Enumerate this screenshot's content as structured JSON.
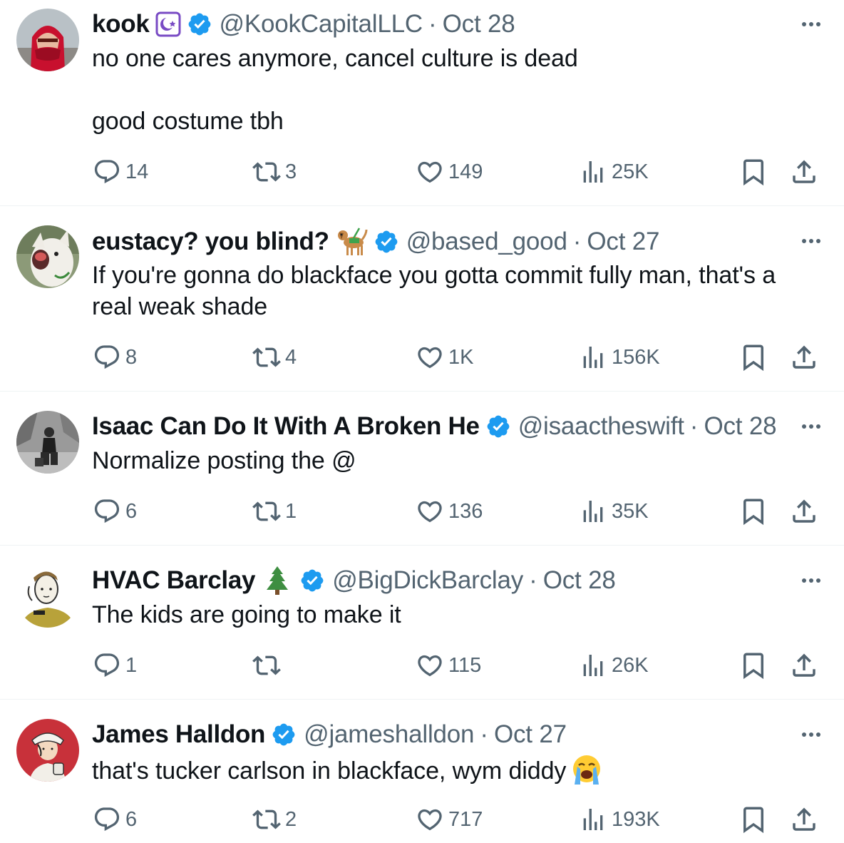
{
  "colors": {
    "verified": "#1d9bf0",
    "affiliate": "#794bc4",
    "muted": "#536471",
    "text": "#0f1419"
  },
  "tweets": [
    {
      "name": "kook",
      "handle": "@KookCapitalLLC",
      "date": "Oct 28",
      "text": "no one cares anymore, cancel culture is dead\n\ngood costume tbh",
      "replies": "14",
      "reposts": "3",
      "likes": "149",
      "views": "25K",
      "badges": [
        "affiliate-icon",
        "verified-icon"
      ]
    },
    {
      "name": "eustacy? you blind?",
      "handle": "@based_good",
      "date": "Oct 27",
      "text": "If you're gonna do blackface you gotta commit fully man, that's a real weak shade",
      "replies": "8",
      "reposts": "4",
      "likes": "1K",
      "views": "156K",
      "badges": [
        "guide-dog-emoji",
        "verified-icon"
      ]
    },
    {
      "name": "Isaac Can Do It With A Broken He",
      "handle": "@isaactheswift",
      "date": "Oct 28",
      "text": "Normalize posting the @",
      "replies": "6",
      "reposts": "1",
      "likes": "136",
      "views": "35K",
      "badges": [
        "verified-icon"
      ]
    },
    {
      "name": "HVAC Barclay",
      "handle": "@BigDickBarclay",
      "date": "Oct 28",
      "text": "The kids are going to make it",
      "replies": "1",
      "reposts": "",
      "likes": "115",
      "views": "26K",
      "badges": [
        "evergreen-tree-emoji",
        "verified-icon"
      ]
    },
    {
      "name": "James Halldon",
      "handle": "@jameshalldon",
      "date": "Oct 27",
      "text": "that's tucker carlson in blackface, wym diddy",
      "replies": "6",
      "reposts": "2",
      "likes": "717",
      "views": "193K",
      "badges": [
        "verified-icon"
      ],
      "text_emoji": "loudly-crying-face-emoji"
    }
  ]
}
